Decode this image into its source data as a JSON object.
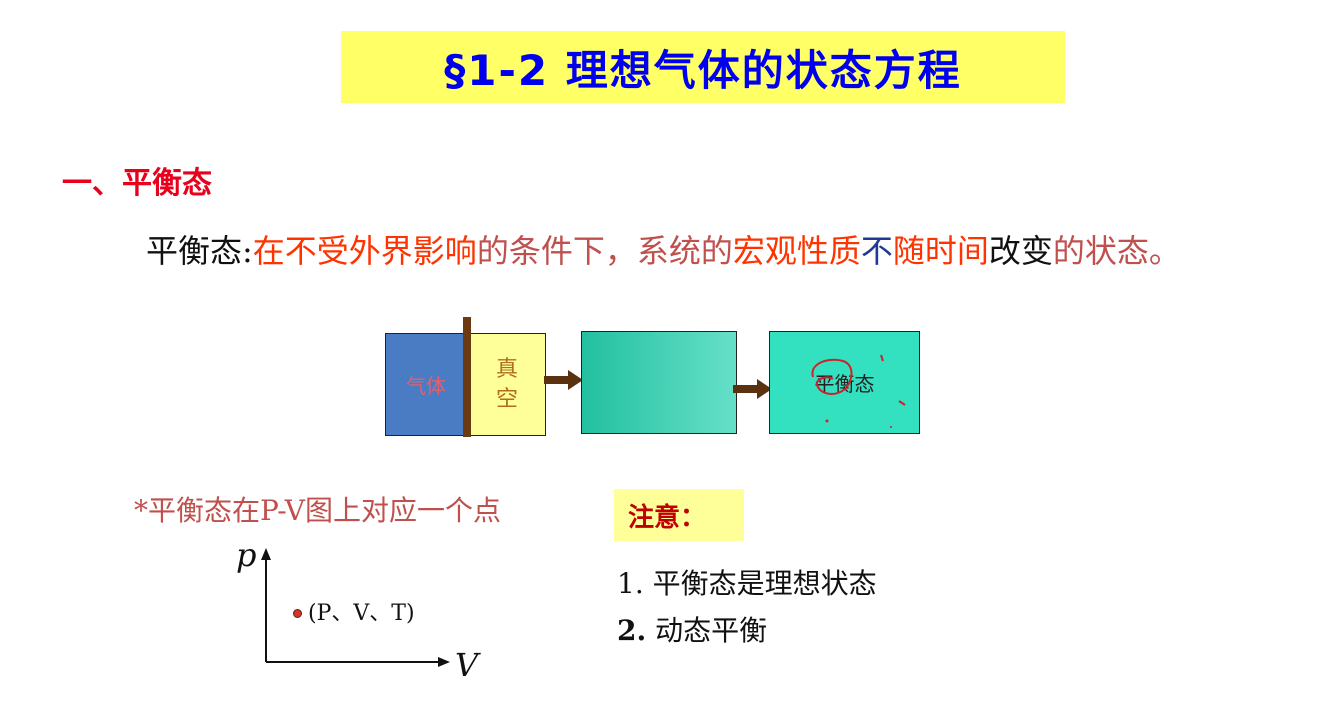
{
  "slide": {
    "title": "§1-2 理想气体的状态方程",
    "section_heading": "一、平衡态",
    "definition": {
      "term": "平衡态:",
      "part1": "在不受外界影响",
      "part2": "的条件下，系统的",
      "part3": "宏观性质",
      "part4": "不",
      "part5": "随时间",
      "part6": "改变",
      "part7": "的状态。"
    },
    "diagram": {
      "gas_label": "气体",
      "vacuum_label": "真空",
      "equilibrium_label": "平衡态"
    },
    "pv_note": "*平衡态在P-V图上对应一个点",
    "pv_chart": {
      "y_axis_label": "p",
      "x_axis_label": "V",
      "point_label": "(P、V、T)"
    },
    "notice": {
      "label": "注意：",
      "item1": "1. 平衡态是理想状态",
      "item2_num": "2.",
      "item2_text": " 动态平衡"
    }
  },
  "colors": {
    "title_text": "#0000ee",
    "title_background": "#ffff66",
    "heading": "#e8001c",
    "highlight_red": "#ff3300",
    "highlight_rose": "#c0504d",
    "highlight_blue": "#1f3a93"
  }
}
